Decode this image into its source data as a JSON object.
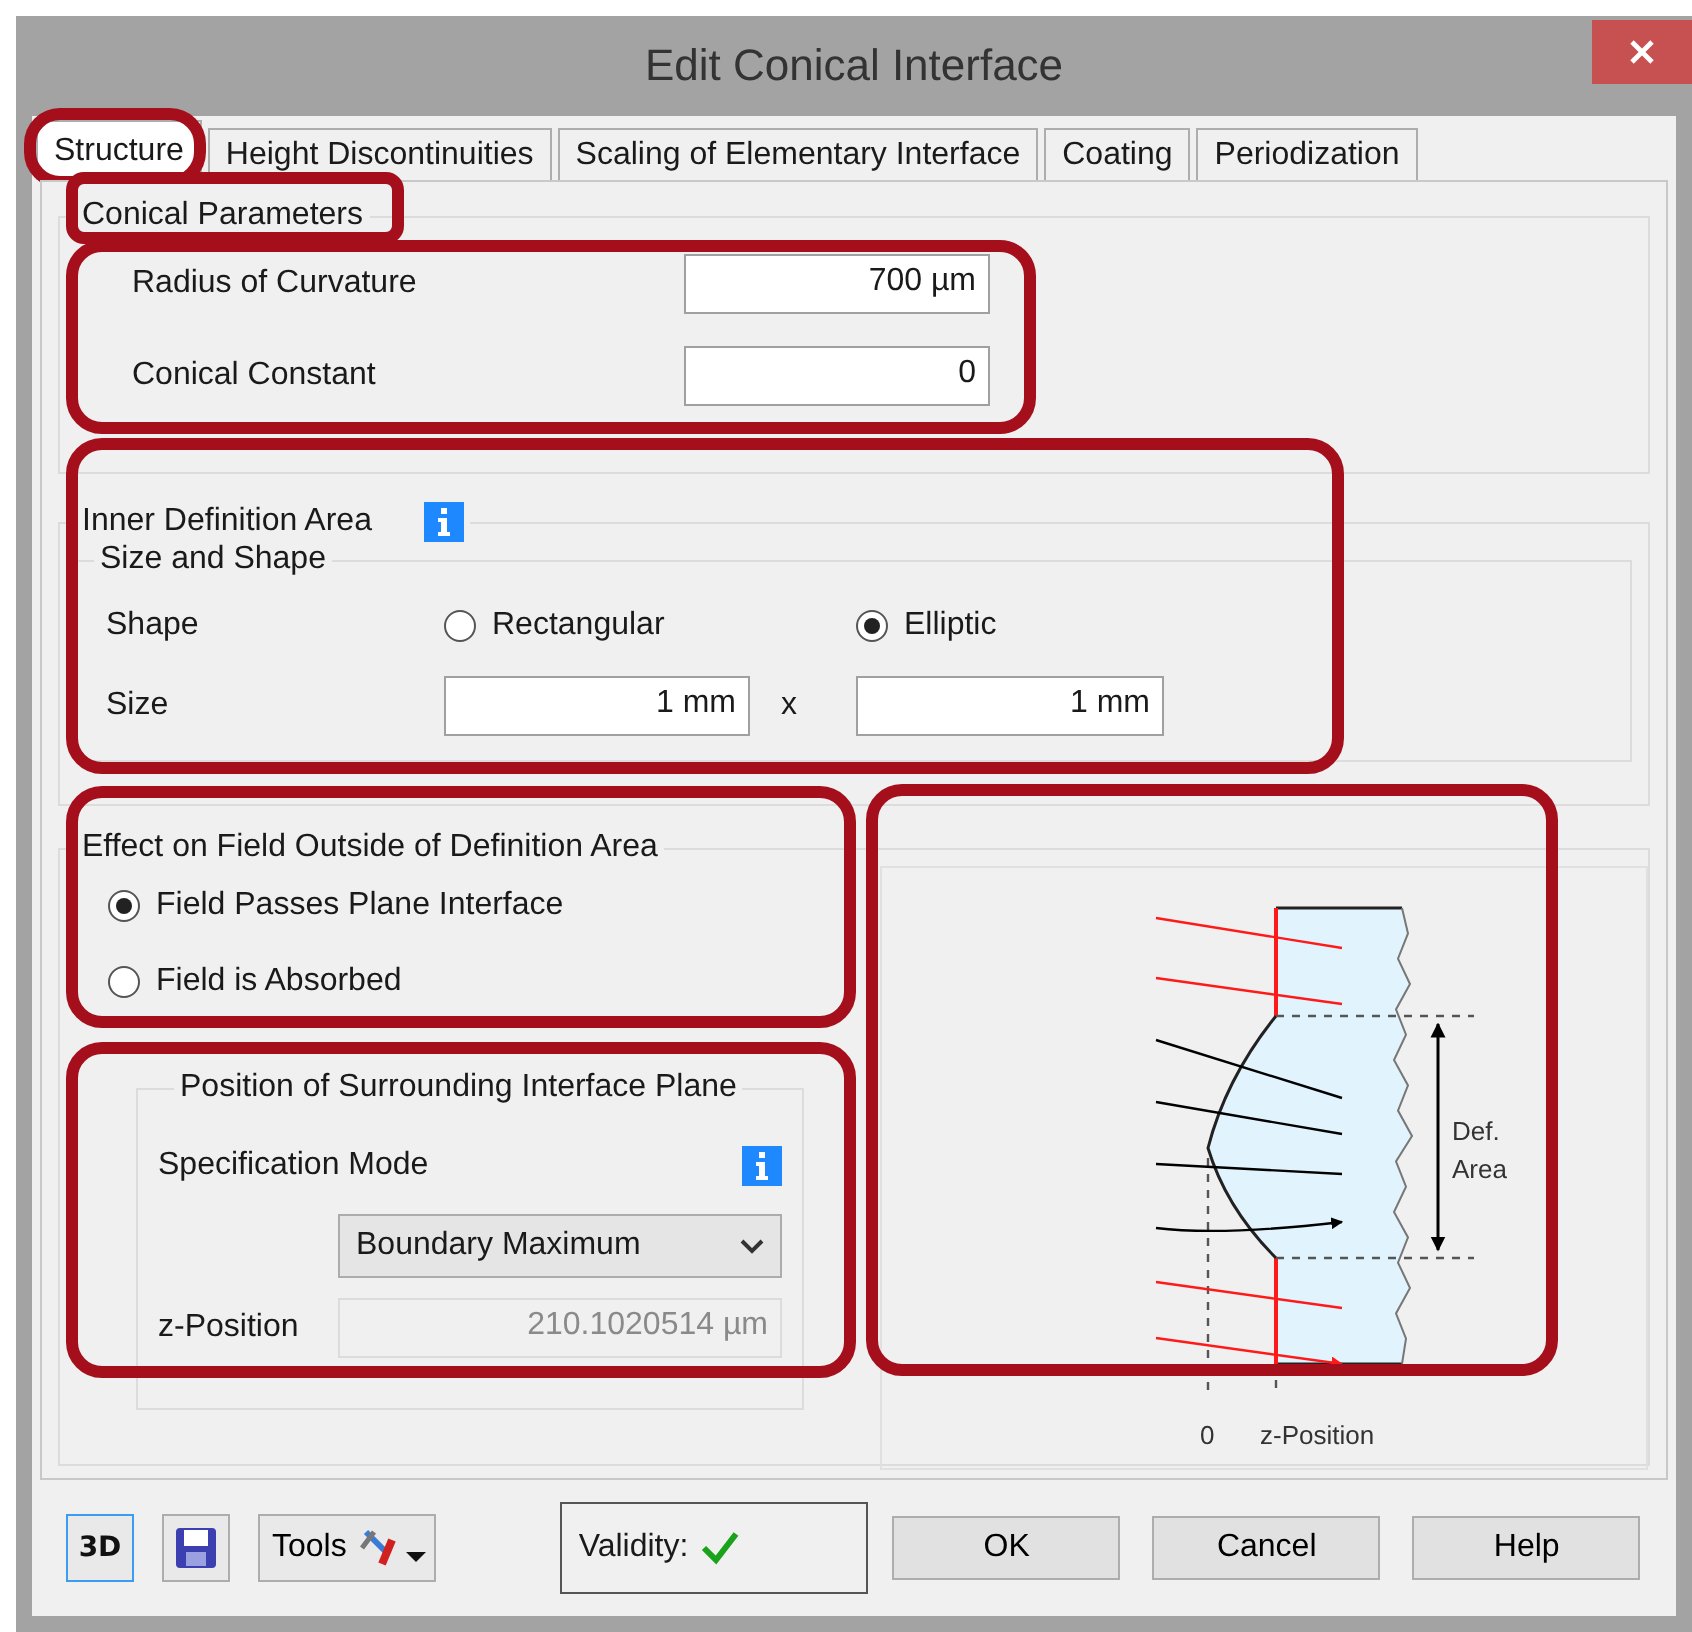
{
  "window": {
    "title": "Edit Conical Interface"
  },
  "tabs": [
    {
      "label": "Structure",
      "selected": true,
      "highlighted": true
    },
    {
      "label": "Height Discontinuities",
      "selected": false,
      "highlighted": false
    },
    {
      "label": "Scaling of Elementary Interface",
      "selected": false,
      "highlighted": false
    },
    {
      "label": "Coating",
      "selected": false,
      "highlighted": false
    },
    {
      "label": "Periodization",
      "selected": false,
      "highlighted": false
    }
  ],
  "conical_parameters": {
    "title": "Conical Parameters",
    "title_highlighted": true,
    "fields_highlighted": true,
    "fields": [
      {
        "label": "Radius of Curvature",
        "value": "700 µm"
      },
      {
        "label": "Conical Constant",
        "value": "0"
      }
    ]
  },
  "inner_definition_area": {
    "title": "Inner Definition Area",
    "highlighted": true,
    "size_and_shape": {
      "title": "Size and Shape",
      "shape_label": "Shape",
      "shape_options": [
        {
          "label": "Rectangular",
          "selected": false
        },
        {
          "label": "Elliptic",
          "selected": true
        }
      ],
      "size_label": "Size",
      "size_x": "1 mm",
      "separator": "x",
      "size_y": "1 mm"
    }
  },
  "effect_outside": {
    "title": "Effect on Field Outside of Definition Area",
    "highlighted": true,
    "options": [
      {
        "label": "Field Passes Plane Interface",
        "selected": true
      },
      {
        "label": "Field is Absorbed",
        "selected": false
      }
    ]
  },
  "surrounding_plane": {
    "title": "Position of Surrounding Interface Plane",
    "highlighted": true,
    "mode_label": "Specification Mode",
    "mode_value": "Boundary Maximum",
    "z_label": "z-Position",
    "z_value": "210.1020514 µm",
    "z_disabled": true
  },
  "diagram": {
    "highlighted": true,
    "area_label_1": "Def.",
    "area_label_2": "Area",
    "axis_zero": "0",
    "axis_label": "z-Position"
  },
  "footer": {
    "view3d_label": "3D",
    "tools": "Tools",
    "validity_label": "Validity:",
    "valid": true,
    "buttons": [
      "OK",
      "Cancel",
      "Help"
    ]
  }
}
